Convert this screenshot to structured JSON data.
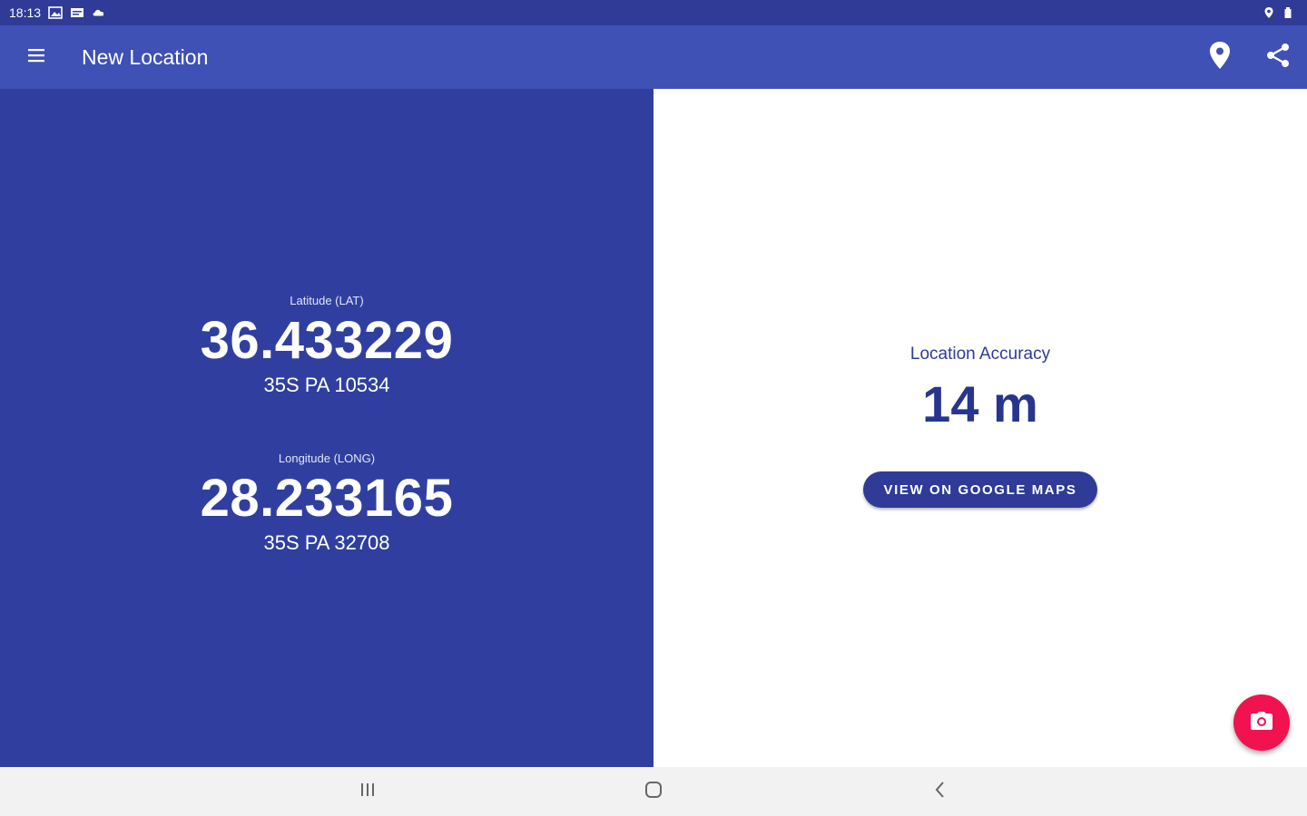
{
  "status_bar": {
    "time": "18:13"
  },
  "app_bar": {
    "title": "New Location"
  },
  "latitude": {
    "label": "Latitude (LAT)",
    "value": "36.433229",
    "mgrs": "35S PA 10534"
  },
  "longitude": {
    "label": "Longitude (LONG)",
    "value": "28.233165",
    "mgrs": "35S PA 32708"
  },
  "accuracy": {
    "label": "Location Accuracy",
    "value": "14 m"
  },
  "maps_button": {
    "label": "VIEW ON GOOGLE MAPS"
  },
  "colors": {
    "status_bar": "#2f3b97",
    "app_bar": "#3f51b5",
    "left_panel": "#303f9f",
    "accent": "#f0134f",
    "nav_bar": "#f2f2f2"
  },
  "icons": {
    "menu": "hamburger-menu-icon",
    "place": "map-pin-icon",
    "share": "share-icon",
    "camera": "camera-icon",
    "recents": "recents-icon",
    "home": "home-icon",
    "back": "back-icon"
  }
}
